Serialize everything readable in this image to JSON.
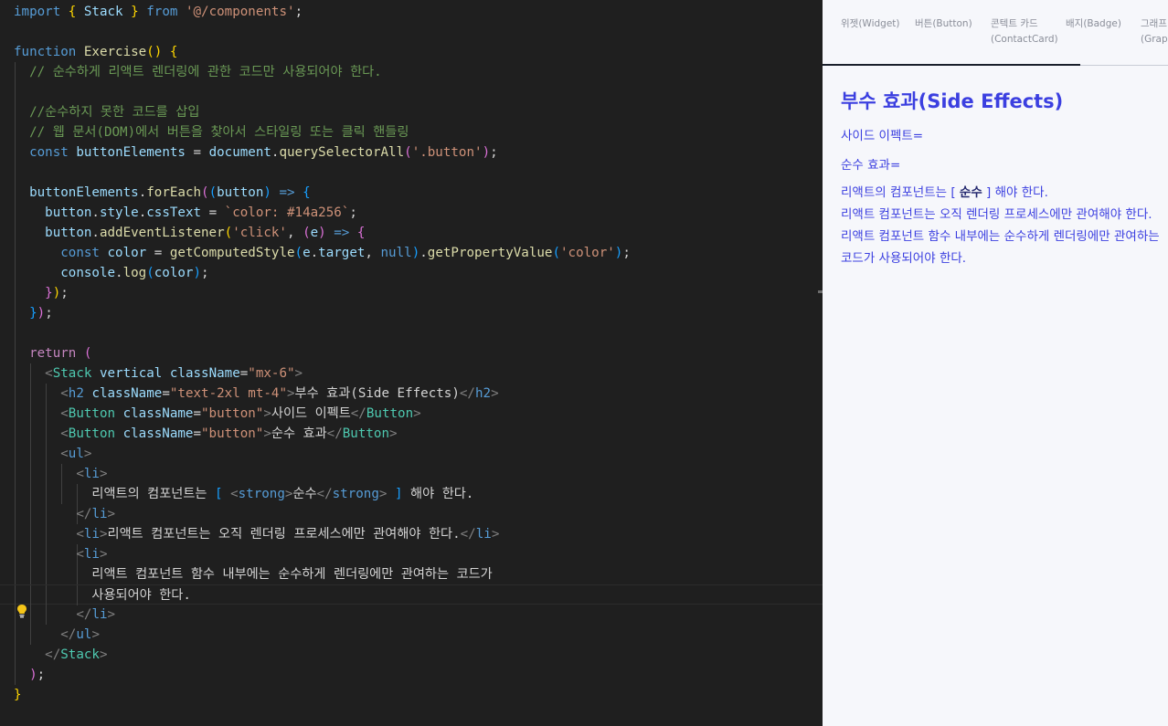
{
  "editor": {
    "lines": [
      [
        [
          "kw",
          "import"
        ],
        [
          "txt",
          " "
        ],
        [
          "b1",
          "{"
        ],
        [
          "txt",
          " "
        ],
        [
          "var",
          "Stack"
        ],
        [
          "txt",
          " "
        ],
        [
          "b1",
          "}"
        ],
        [
          "txt",
          " "
        ],
        [
          "kw",
          "from"
        ],
        [
          "txt",
          " "
        ],
        [
          "str",
          "'@/components'"
        ],
        [
          "txt",
          ";"
        ]
      ],
      [],
      [
        [
          "kw",
          "function"
        ],
        [
          "txt",
          " "
        ],
        [
          "fn",
          "Exercise"
        ],
        [
          "b1",
          "()"
        ],
        [
          "txt",
          " "
        ],
        [
          "b1",
          "{"
        ]
      ],
      [
        [
          "txt",
          "  "
        ],
        [
          "cmt",
          "// 순수하게 리액트 렌더링에 관한 코드만 사용되어야 한다."
        ]
      ],
      [],
      [
        [
          "txt",
          "  "
        ],
        [
          "cmt",
          "//순수하지 못한 코드를 삽입"
        ]
      ],
      [
        [
          "txt",
          "  "
        ],
        [
          "cmt",
          "// 웹 문서(DOM)에서 버튼을 찾아서 스타일링 또는 클릭 핸들링"
        ]
      ],
      [
        [
          "txt",
          "  "
        ],
        [
          "kw",
          "const"
        ],
        [
          "txt",
          " "
        ],
        [
          "var",
          "buttonElements"
        ],
        [
          "txt",
          " = "
        ],
        [
          "var",
          "document"
        ],
        [
          "txt",
          "."
        ],
        [
          "fn",
          "querySelectorAll"
        ],
        [
          "b2",
          "("
        ],
        [
          "str",
          "'.button'"
        ],
        [
          "b2",
          ")"
        ],
        [
          "txt",
          ";"
        ]
      ],
      [],
      [
        [
          "txt",
          "  "
        ],
        [
          "var",
          "buttonElements"
        ],
        [
          "txt",
          "."
        ],
        [
          "fn",
          "forEach"
        ],
        [
          "b2",
          "("
        ],
        [
          "b3",
          "("
        ],
        [
          "var",
          "button"
        ],
        [
          "b3",
          ")"
        ],
        [
          "txt",
          " "
        ],
        [
          "kw",
          "=>"
        ],
        [
          "txt",
          " "
        ],
        [
          "b3",
          "{"
        ]
      ],
      [
        [
          "txt",
          "    "
        ],
        [
          "var",
          "button"
        ],
        [
          "txt",
          "."
        ],
        [
          "var",
          "style"
        ],
        [
          "txt",
          "."
        ],
        [
          "var",
          "cssText"
        ],
        [
          "txt",
          " = "
        ],
        [
          "str",
          "`color: #14a256`"
        ],
        [
          "txt",
          ";"
        ]
      ],
      [
        [
          "txt",
          "    "
        ],
        [
          "var",
          "button"
        ],
        [
          "txt",
          "."
        ],
        [
          "fn",
          "addEventListener"
        ],
        [
          "b1",
          "("
        ],
        [
          "str",
          "'click'"
        ],
        [
          "txt",
          ", "
        ],
        [
          "b2",
          "("
        ],
        [
          "var",
          "e"
        ],
        [
          "b2",
          ")"
        ],
        [
          "txt",
          " "
        ],
        [
          "kw",
          "=>"
        ],
        [
          "txt",
          " "
        ],
        [
          "b2",
          "{"
        ]
      ],
      [
        [
          "txt",
          "      "
        ],
        [
          "kw",
          "const"
        ],
        [
          "txt",
          " "
        ],
        [
          "var",
          "color"
        ],
        [
          "txt",
          " = "
        ],
        [
          "fn",
          "getComputedStyle"
        ],
        [
          "b3",
          "("
        ],
        [
          "var",
          "e"
        ],
        [
          "txt",
          "."
        ],
        [
          "var",
          "target"
        ],
        [
          "txt",
          ", "
        ],
        [
          "kw",
          "null"
        ],
        [
          "b3",
          ")"
        ],
        [
          "txt",
          "."
        ],
        [
          "fn",
          "getPropertyValue"
        ],
        [
          "b3",
          "("
        ],
        [
          "str",
          "'color'"
        ],
        [
          "b3",
          ")"
        ],
        [
          "txt",
          ";"
        ]
      ],
      [
        [
          "txt",
          "      "
        ],
        [
          "var",
          "console"
        ],
        [
          "txt",
          "."
        ],
        [
          "fn",
          "log"
        ],
        [
          "b3",
          "("
        ],
        [
          "var",
          "color"
        ],
        [
          "b3",
          ")"
        ],
        [
          "txt",
          ";"
        ]
      ],
      [
        [
          "txt",
          "    "
        ],
        [
          "b2",
          "}"
        ],
        [
          "b1",
          ")"
        ],
        [
          "txt",
          ";"
        ]
      ],
      [
        [
          "txt",
          "  "
        ],
        [
          "b3",
          "}"
        ],
        [
          "b2",
          ")"
        ],
        [
          "txt",
          ";"
        ]
      ],
      [],
      [
        [
          "txt",
          "  "
        ],
        [
          "ctl",
          "return"
        ],
        [
          "txt",
          " "
        ],
        [
          "b2",
          "("
        ]
      ],
      [
        [
          "txt",
          "    "
        ],
        [
          "pun",
          "<"
        ],
        [
          "comp",
          "Stack"
        ],
        [
          "txt",
          " "
        ],
        [
          "attr",
          "vertical"
        ],
        [
          "txt",
          " "
        ],
        [
          "attr",
          "className"
        ],
        [
          "txt",
          "="
        ],
        [
          "str",
          "\"mx-6\""
        ],
        [
          "pun",
          ">"
        ]
      ],
      [
        [
          "txt",
          "      "
        ],
        [
          "pun",
          "<"
        ],
        [
          "tag",
          "h2"
        ],
        [
          "txt",
          " "
        ],
        [
          "attr",
          "className"
        ],
        [
          "txt",
          "="
        ],
        [
          "str",
          "\"text-2xl mt-4\""
        ],
        [
          "pun",
          ">"
        ],
        [
          "txt",
          "부수 효과(Side Effects)"
        ],
        [
          "pun",
          "</"
        ],
        [
          "tag",
          "h2"
        ],
        [
          "pun",
          ">"
        ]
      ],
      [
        [
          "txt",
          "      "
        ],
        [
          "pun",
          "<"
        ],
        [
          "comp",
          "Button"
        ],
        [
          "txt",
          " "
        ],
        [
          "attr",
          "className"
        ],
        [
          "txt",
          "="
        ],
        [
          "str",
          "\"button\""
        ],
        [
          "pun",
          ">"
        ],
        [
          "txt",
          "사이드 이펙트"
        ],
        [
          "pun",
          "</"
        ],
        [
          "comp",
          "Button"
        ],
        [
          "pun",
          ">"
        ]
      ],
      [
        [
          "txt",
          "      "
        ],
        [
          "pun",
          "<"
        ],
        [
          "comp",
          "Button"
        ],
        [
          "txt",
          " "
        ],
        [
          "attr",
          "className"
        ],
        [
          "txt",
          "="
        ],
        [
          "str",
          "\"button\""
        ],
        [
          "pun",
          ">"
        ],
        [
          "txt",
          "순수 효과"
        ],
        [
          "pun",
          "</"
        ],
        [
          "comp",
          "Button"
        ],
        [
          "pun",
          ">"
        ]
      ],
      [
        [
          "txt",
          "      "
        ],
        [
          "pun",
          "<"
        ],
        [
          "tag",
          "ul"
        ],
        [
          "pun",
          ">"
        ]
      ],
      [
        [
          "txt",
          "        "
        ],
        [
          "pun",
          "<"
        ],
        [
          "tag",
          "li"
        ],
        [
          "pun",
          ">"
        ]
      ],
      [
        [
          "txt",
          "          리액트의 컴포넌트는 "
        ],
        [
          "b3",
          "["
        ],
        [
          "txt",
          " "
        ],
        [
          "pun",
          "<"
        ],
        [
          "tag",
          "strong"
        ],
        [
          "pun",
          ">"
        ],
        [
          "txt",
          "순수"
        ],
        [
          "pun",
          "</"
        ],
        [
          "tag",
          "strong"
        ],
        [
          "pun",
          ">"
        ],
        [
          "txt",
          " "
        ],
        [
          "b3",
          "]"
        ],
        [
          "txt",
          " 해야 한다."
        ]
      ],
      [
        [
          "txt",
          "        "
        ],
        [
          "pun",
          "</"
        ],
        [
          "tag",
          "li"
        ],
        [
          "pun",
          ">"
        ]
      ],
      [
        [
          "txt",
          "        "
        ],
        [
          "pun",
          "<"
        ],
        [
          "tag",
          "li"
        ],
        [
          "pun",
          ">"
        ],
        [
          "txt",
          "리액트 컴포넌트는 오직 렌더링 프로세스에만 관여해야 한다."
        ],
        [
          "pun",
          "</"
        ],
        [
          "tag",
          "li"
        ],
        [
          "pun",
          ">"
        ]
      ],
      [
        [
          "txt",
          "        "
        ],
        [
          "pun",
          "<"
        ],
        [
          "tag",
          "li"
        ],
        [
          "pun",
          ">"
        ]
      ],
      [
        [
          "txt",
          "          리액트 컴포넌트 함수 내부에는 순수하게 렌더링에만 관여하는 코드가"
        ]
      ],
      [
        [
          "txt",
          "          사용되어야 한다."
        ]
      ],
      [
        [
          "txt",
          "        "
        ],
        [
          "pun",
          "</"
        ],
        [
          "tag",
          "li"
        ],
        [
          "pun",
          ">"
        ]
      ],
      [
        [
          "txt",
          "      "
        ],
        [
          "pun",
          "</"
        ],
        [
          "tag",
          "ul"
        ],
        [
          "pun",
          ">"
        ]
      ],
      [
        [
          "txt",
          "    "
        ],
        [
          "pun",
          "</"
        ],
        [
          "comp",
          "Stack"
        ],
        [
          "pun",
          ">"
        ]
      ],
      [
        [
          "txt",
          "  "
        ],
        [
          "b2",
          ")"
        ],
        [
          "txt",
          ";"
        ]
      ],
      [
        [
          "b1",
          "}"
        ]
      ]
    ]
  },
  "preview": {
    "tabs": [
      {
        "label": "위젯(Widget)"
      },
      {
        "label": "버튼(Button)"
      },
      {
        "label": "콘텍트 카드\n(ContactCard)"
      },
      {
        "label": "배지(Badge)"
      },
      {
        "label": "그래프\n(Grap"
      }
    ],
    "title": "부수 효과(Side Effects)",
    "button_side_effect": "사이드 이펙트=",
    "button_pure": "순수 효과=",
    "list": {
      "item1_before": "리액트의 컴포넌트는 [ ",
      "item1_strong": "순수",
      "item1_after": " ] 해야 한다.",
      "item2": "리액트 컴포넌트는 오직 렌더링 프로세스에만 관여해야 한다.",
      "item3": "리액트 컴포넌트 함수 내부에는 순수하게 렌더링에만 관여하는 코드가 사용되어야 한다."
    }
  }
}
